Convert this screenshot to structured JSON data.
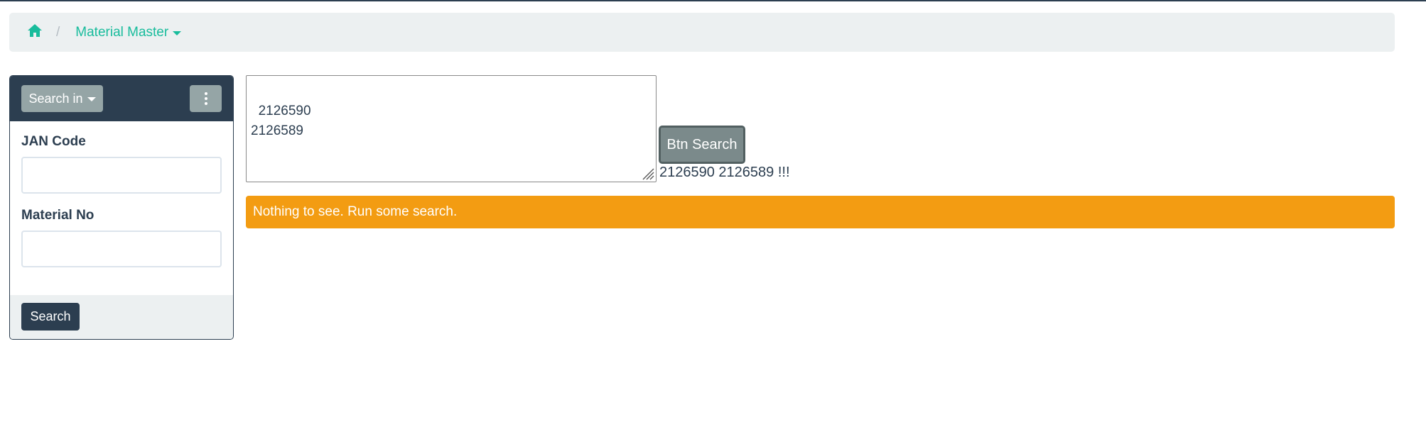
{
  "breadcrumb": {
    "home_icon": "home-icon",
    "separator": "/",
    "current": "Material Master"
  },
  "sidebar": {
    "search_in_label": "Search in",
    "menu_icon": "kebab-menu-icon",
    "fields": [
      {
        "label": "JAN Code",
        "value": ""
      },
      {
        "label": "Material No",
        "value": ""
      }
    ],
    "search_button": "Search"
  },
  "main": {
    "textarea_value": "2126590\n2126589",
    "search_button": "Btn Search",
    "echo": "2126590 2126589 !!!",
    "alert": "Nothing to see. Run some search."
  },
  "colors": {
    "primary": "#2c3e50",
    "accent": "#18bc9c",
    "warning": "#f39c12",
    "secondary": "#95a5a6",
    "light": "#ecf0f1"
  }
}
